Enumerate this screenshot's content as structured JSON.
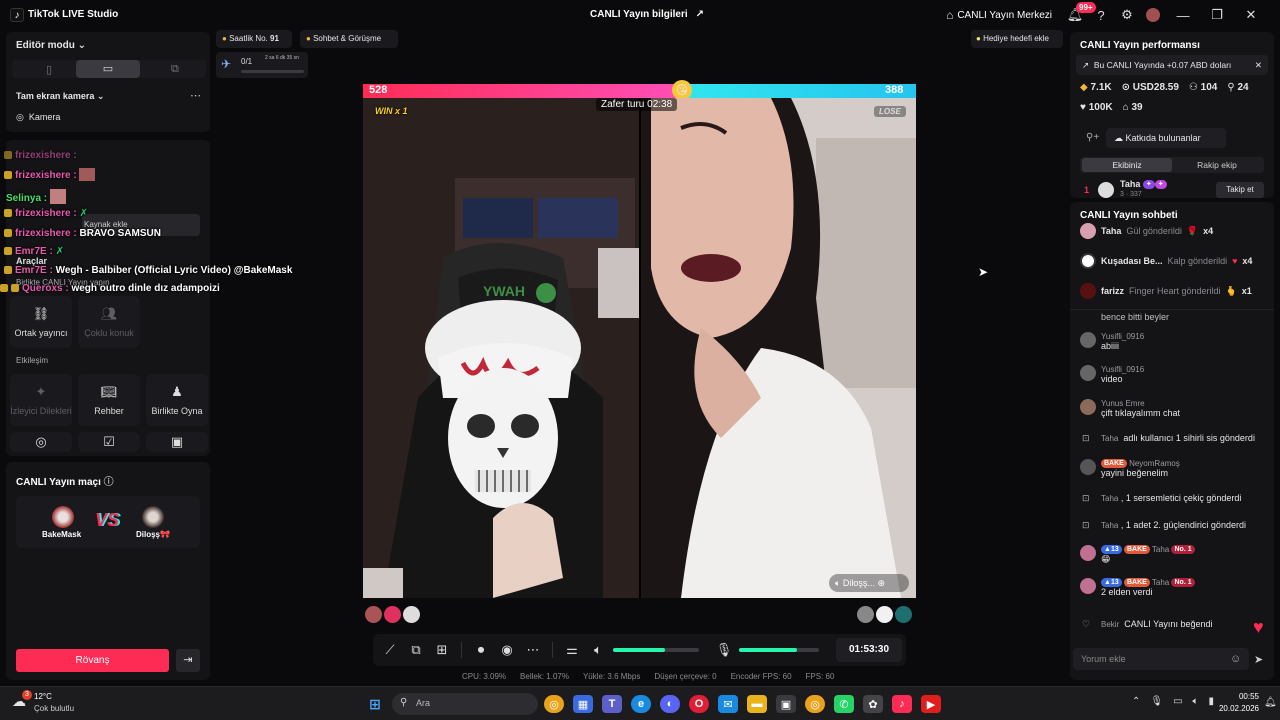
{
  "app": {
    "title": "TikTok LIVE Studio",
    "logo": "♪",
    "live_info": "CANLI Yayın bilgileri",
    "live_center": "CANLI Yayın Merkezi",
    "notif_badge": "99+"
  },
  "left": {
    "editor_mode": "Editör modu",
    "camera_title": "Tam ekran kamera",
    "camera_item": "Kamera",
    "add_source": "Kaynak ekle",
    "tools": "Araçlar",
    "live_together": "Birlikte CANLI Yayın yapın",
    "tiles_row1": [
      {
        "label": "Ortak yayıncı",
        "icon": "link-icon"
      },
      {
        "label": "Çoklu konuk",
        "icon": "users-icon"
      }
    ],
    "interaction": "Etkileşim",
    "tiles_row2": [
      {
        "label": "İzleyici Dilekleri",
        "icon": "wishes-icon"
      },
      {
        "label": "Rehber",
        "icon": "guide-icon"
      },
      {
        "label": "Birlikte Oyna",
        "icon": "play-together-icon"
      }
    ],
    "match_title": "CANLI Yayın maçı",
    "player1": "BakeMask",
    "player2": "Diloşş🎀",
    "vs": "VS",
    "rematch": "Rövanş"
  },
  "overlay_chat": [
    {
      "user": "frizexishere",
      "text": ""
    },
    {
      "user": "Selinya",
      "text": ""
    },
    {
      "user": "frizexishere",
      "text": ""
    },
    {
      "user": "frizexishere",
      "text": "BRAVO SAMSUN"
    },
    {
      "user": "Emr7E",
      "text": ""
    },
    {
      "user": "Emr7E",
      "text": "Wegh - Balbiber (Official Lyric Video) @BakeMask"
    },
    {
      "user": "Queroxs",
      "text": "wegh outro dinle dız adampoizi"
    }
  ],
  "top": {
    "hourly_rank_label": "Saatlik No.",
    "hourly_rank_value": "91",
    "chat_meet": "Sohbet & Görüşme",
    "goal_progress": "0/1",
    "goal_time": "2 sa 6 dk 35 sn",
    "gift_goal": "Hediye hedefi ekle"
  },
  "battle": {
    "score_left": "528",
    "score_right": "388",
    "win_label": "WIN x 1",
    "lose_label": "LOSE",
    "timer": "Zafer turu 02:38",
    "opponent_name": "Diloşş"
  },
  "controls": {
    "timer": "01:53:30",
    "mic_level": 0.72,
    "audio_level": 0.6
  },
  "stats": [
    "CPU: 3.09%",
    "Bellek: 1.07%",
    "Yükle: 3.6 Mbps",
    "Düşen çerçeve: 0",
    "Encoder FPS: 60",
    "FPS: 60"
  ],
  "right": {
    "perf_title": "CANLI Yayın performansı",
    "earn_note": "Bu CANLI Yayında +0.07 ABD doları",
    "stat1": "7.1K",
    "stat2": "USD28.59",
    "stat3": "104",
    "stat4": "24",
    "stat5": "100K",
    "stat6": "39",
    "contributors": "Katkıda bulunanlar",
    "tab_team": "Ekibiniz",
    "tab_rival": "Rakip ekip",
    "top_rank": "1",
    "top_user": "Taha",
    "top_sub": "3 · 337",
    "follow": "Takip et",
    "chat_title": "CANLI Yayın sohbeti",
    "gifts": [
      {
        "user": "Taha",
        "action": "Gül gönderildi",
        "count": "x4",
        "gift": "🌹"
      },
      {
        "user": "Kuşadası Be...",
        "action": "Kalp gönderildi",
        "count": "x4",
        "gift": "❤️"
      },
      {
        "user": "farizz",
        "action": "Finger Heart gönderildi",
        "count": "x1",
        "gift": "🫰"
      }
    ],
    "messages": [
      {
        "user": "",
        "text": "bence bitti beyler"
      },
      {
        "user": "Yusifli_0916",
        "text": "abiiii"
      },
      {
        "user": "Yusifli_0916",
        "text": "video"
      },
      {
        "user": "Yunus Emre",
        "text": "çift tıklayalımm chat"
      },
      {
        "user": "Taha",
        "text": "adlı kullanıcı 1 sihirli sis gönderdi"
      },
      {
        "user": "NeyomRamoş",
        "text": "yayini beğenelim",
        "chip": "BAKE"
      },
      {
        "user": "Taha",
        "text": ", 1 sersemletici çekiç gönderdi"
      },
      {
        "user": "Taha",
        "text": ", 1 adet 2. güçlendirici gönderdi"
      },
      {
        "user": "Taha",
        "text": "😁",
        "chip": "BAKE",
        "lvl": "13",
        "no": "No. 1"
      },
      {
        "user": "Taha",
        "text": "2 elden verdi",
        "chip": "BAKE",
        "lvl": "13",
        "no": "No. 1"
      },
      {
        "user": "Bekir",
        "text": "CANLI Yayını beğendi"
      }
    ],
    "comment_placeholder": "Yorum ekle"
  },
  "taskbar": {
    "weather_temp": "12°C",
    "weather_desc": "Çok bulutlu",
    "search": "Ara",
    "time": "00:55",
    "date": "20.02.2026",
    "weather_badge": "3"
  }
}
